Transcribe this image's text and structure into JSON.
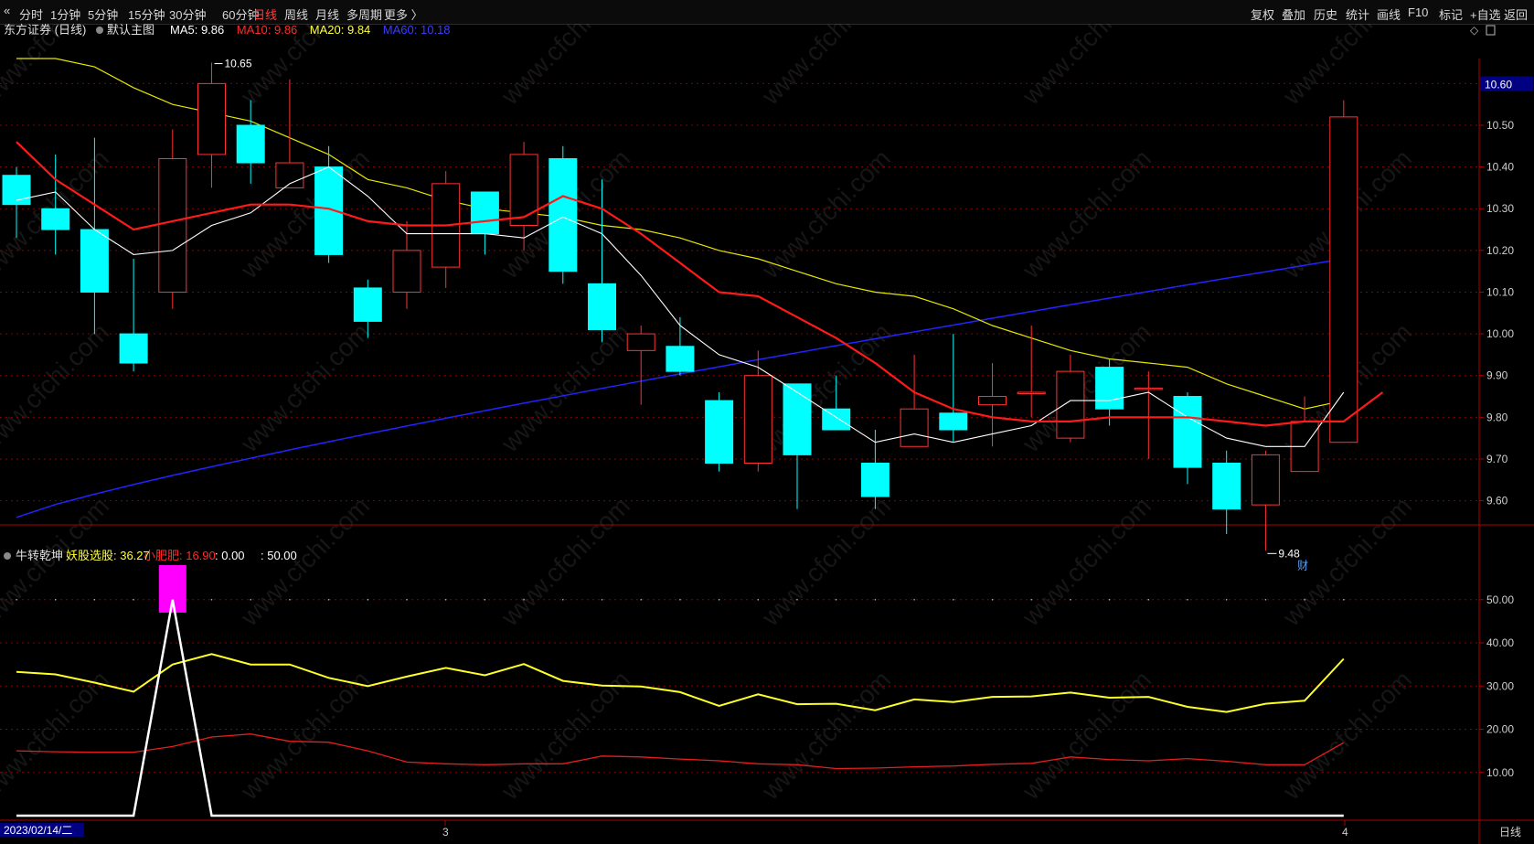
{
  "toolbar": {
    "left_items": [
      "分时",
      "1分钟",
      "5分钟",
      "15分钟",
      "30分钟",
      "60分钟",
      "日线",
      "周线",
      "月线",
      "多周期",
      "更多 〉"
    ],
    "active": "日线",
    "right_items": [
      "复权",
      "叠加",
      "历史",
      "统计",
      "画线",
      "F10",
      "标记",
      "+自选",
      "返回"
    ]
  },
  "main": {
    "stock": "东方证券 (日线)",
    "template": "默认主图",
    "ma_labels": [
      {
        "text": "MA5: 9.86",
        "color": "#ffffff"
      },
      {
        "text": "MA10: 9.86",
        "color": "#ff2a2a"
      },
      {
        "text": "MA20: 9.84",
        "color": "#ffff3c"
      },
      {
        "text": "MA60: 10.18",
        "color": "#3c3cff"
      }
    ],
    "price_tag": "10.60",
    "high_label": "10.65",
    "low_label": "9.48",
    "cai_marker": "财",
    "y_ticks": [
      "10.50",
      "10.40",
      "10.30",
      "10.20",
      "10.10",
      "10.00",
      "9.90",
      "9.80",
      "9.70",
      "9.60"
    ]
  },
  "indicator": {
    "name": "牛转乾坤",
    "labels": [
      {
        "text": "妖股选股: 36.27",
        "color": "#ffff3c"
      },
      {
        "text": "小肥肥: 16.90",
        "color": "#ff2a2a"
      },
      {
        "text": ": 0.00",
        "color": "#ffffff"
      },
      {
        "text": ": 50.00",
        "color": "#ffffff"
      }
    ],
    "y_ticks": [
      "50.00",
      "40.00",
      "30.00",
      "20.00",
      "10.00"
    ]
  },
  "bottom": {
    "date": "2023/02/14/二",
    "month_marks": [
      "3",
      "4"
    ],
    "period": "日线"
  },
  "colors": {
    "up": "#ff3232",
    "down": "#00ffff",
    "ma5": "#ffffff",
    "ma10": "#ff1a1a",
    "ma20": "#e6e600",
    "ma60": "#2323ff",
    "indicator_yellow": "#ffff28",
    "indicator_red": "#e61e1e",
    "signal_magenta": "#ff00ff",
    "grid_red": "#8c0000"
  },
  "watermark": "www.cfchi.com",
  "chart_data": {
    "type": "candlestick",
    "price_range": [
      9.45,
      10.66
    ],
    "candles": [
      {
        "o": 10.38,
        "c": 10.31,
        "h": 10.4,
        "l": 10.23
      },
      {
        "o": 10.3,
        "c": 10.25,
        "h": 10.43,
        "l": 10.19
      },
      {
        "o": 10.25,
        "c": 10.1,
        "h": 10.47,
        "l": 10.0
      },
      {
        "o": 10.0,
        "c": 9.93,
        "h": 10.18,
        "l": 9.91
      },
      {
        "o": 10.1,
        "c": 10.42,
        "h": 10.49,
        "l": 10.06
      },
      {
        "o": 10.43,
        "c": 10.6,
        "h": 10.65,
        "l": 10.35
      },
      {
        "o": 10.5,
        "c": 10.41,
        "h": 10.56,
        "l": 10.36
      },
      {
        "o": 10.35,
        "c": 10.41,
        "h": 10.61,
        "l": 10.35
      },
      {
        "o": 10.4,
        "c": 10.19,
        "h": 10.45,
        "l": 10.17
      },
      {
        "o": 10.11,
        "c": 10.03,
        "h": 10.13,
        "l": 9.99
      },
      {
        "o": 10.1,
        "c": 10.2,
        "h": 10.27,
        "l": 10.06
      },
      {
        "o": 10.16,
        "c": 10.36,
        "h": 10.39,
        "l": 10.11
      },
      {
        "o": 10.34,
        "c": 10.24,
        "h": 10.34,
        "l": 10.19
      },
      {
        "o": 10.26,
        "c": 10.43,
        "h": 10.46,
        "l": 10.2
      },
      {
        "o": 10.42,
        "c": 10.15,
        "h": 10.45,
        "l": 10.12
      },
      {
        "o": 10.12,
        "c": 10.01,
        "h": 10.37,
        "l": 9.98
      },
      {
        "o": 9.96,
        "c": 10.0,
        "h": 10.02,
        "l": 9.83
      },
      {
        "o": 9.97,
        "c": 9.91,
        "h": 10.04,
        "l": 9.9
      },
      {
        "o": 9.84,
        "c": 9.69,
        "h": 9.86,
        "l": 9.67
      },
      {
        "o": 9.69,
        "c": 9.9,
        "h": 9.96,
        "l": 9.67
      },
      {
        "o": 9.88,
        "c": 9.71,
        "h": 9.88,
        "l": 9.58
      },
      {
        "o": 9.82,
        "c": 9.77,
        "h": 9.9,
        "l": 9.77
      },
      {
        "o": 9.69,
        "c": 9.61,
        "h": 9.77,
        "l": 9.58
      },
      {
        "o": 9.73,
        "c": 9.82,
        "h": 9.95,
        "l": 9.73
      },
      {
        "o": 9.81,
        "c": 9.77,
        "h": 10.0,
        "l": 9.74
      },
      {
        "o": 9.83,
        "c": 9.85,
        "h": 9.93,
        "l": 9.73
      },
      {
        "o": 9.86,
        "c": 9.86,
        "h": 10.02,
        "l": 9.8
      },
      {
        "o": 9.75,
        "c": 9.91,
        "h": 9.95,
        "l": 9.74
      },
      {
        "o": 9.92,
        "c": 9.82,
        "h": 9.94,
        "l": 9.78
      },
      {
        "o": 9.87,
        "c": 9.87,
        "h": 9.91,
        "l": 9.7
      },
      {
        "o": 9.85,
        "c": 9.68,
        "h": 9.86,
        "l": 9.64
      },
      {
        "o": 9.69,
        "c": 9.58,
        "h": 9.72,
        "l": 9.52
      },
      {
        "o": 9.59,
        "c": 9.71,
        "h": 9.72,
        "l": 9.48
      },
      {
        "o": 9.67,
        "c": 9.79,
        "h": 9.85,
        "l": 9.67
      },
      {
        "o": 9.74,
        "c": 10.52,
        "h": 10.56,
        "l": 9.74
      }
    ],
    "ma5": [
      10.32,
      10.34,
      10.25,
      10.19,
      10.2,
      10.26,
      10.29,
      10.36,
      10.4,
      10.33,
      10.24,
      10.24,
      10.24,
      10.23,
      10.28,
      10.24,
      10.14,
      10.02,
      9.95,
      9.92,
      9.86,
      9.8,
      9.74,
      9.76,
      9.74,
      9.76,
      9.78,
      9.84,
      9.84,
      9.86,
      9.8,
      9.75,
      9.73,
      9.73,
      9.86
    ],
    "ma10": [
      10.46,
      10.37,
      10.31,
      10.25,
      10.27,
      10.29,
      10.31,
      10.31,
      10.3,
      10.27,
      10.26,
      10.26,
      10.27,
      10.28,
      10.33,
      10.3,
      10.24,
      10.17,
      10.1,
      10.09,
      10.04,
      9.99,
      9.93,
      9.86,
      9.82,
      9.8,
      9.79,
      9.79,
      9.8,
      9.8,
      9.8,
      9.79,
      9.78,
      9.79,
      9.79,
      9.86
    ],
    "ma20": [
      10.66,
      10.66,
      10.64,
      10.59,
      10.55,
      10.53,
      10.51,
      10.47,
      10.43,
      10.37,
      10.35,
      10.32,
      10.3,
      10.29,
      10.28,
      10.26,
      10.25,
      10.23,
      10.2,
      10.18,
      10.15,
      10.12,
      10.1,
      10.09,
      10.06,
      10.02,
      9.99,
      9.96,
      9.94,
      9.93,
      9.92,
      9.88,
      9.85,
      9.82,
      9.84
    ],
    "ma60_start": 9.56,
    "ma60_end": 10.18,
    "ind_yellow": [
      33.3,
      32.7,
      30.8,
      28.7,
      35.0,
      37.4,
      35.0,
      35.0,
      31.9,
      30.0,
      32.2,
      34.2,
      32.5,
      35.1,
      31.2,
      30.1,
      29.9,
      28.6,
      25.4,
      28.1,
      25.8,
      25.9,
      24.4,
      26.9,
      26.3,
      27.5,
      27.6,
      28.5,
      27.3,
      27.5,
      25.2,
      24.0,
      25.9,
      26.6,
      36.3
    ],
    "ind_red": [
      15.0,
      14.8,
      14.7,
      14.7,
      16.0,
      18.2,
      18.9,
      17.2,
      17.0,
      15.0,
      12.4,
      12.0,
      11.8,
      12.0,
      12.0,
      13.8,
      13.6,
      13.1,
      12.7,
      12.0,
      11.8,
      10.9,
      11.0,
      11.3,
      11.5,
      11.9,
      12.1,
      13.6,
      13.0,
      12.7,
      13.2,
      12.6,
      11.8,
      11.8,
      16.9
    ],
    "ind_white": [
      0,
      0,
      0,
      0,
      50,
      0,
      0,
      0,
      0,
      0,
      0,
      0,
      0,
      0,
      0,
      0,
      0,
      0,
      0,
      0,
      0,
      0,
      0,
      0,
      0,
      0,
      0,
      0,
      0,
      0,
      0,
      0,
      0,
      0,
      0
    ],
    "ind_range": [
      0,
      58
    ]
  }
}
